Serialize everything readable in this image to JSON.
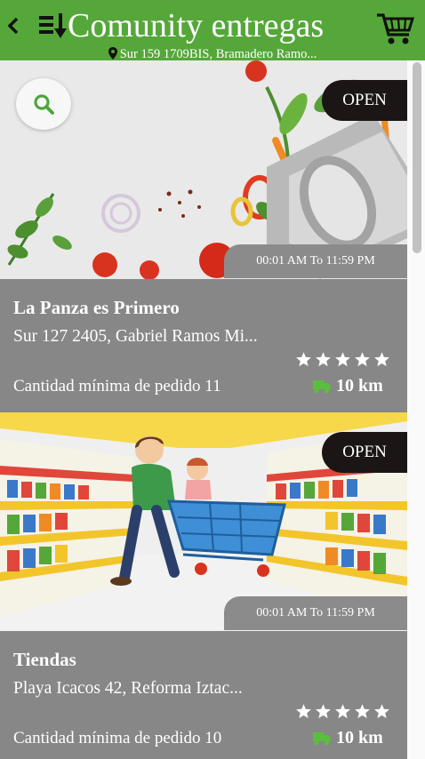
{
  "header": {
    "title": "Comunity entregas",
    "address": "Sur 159 1709BIS, Bramadero Ramo..."
  },
  "colors": {
    "brand_green": "#55a73a",
    "badge_dark": "#1b1515",
    "info_gray": "#878787"
  },
  "icons": [
    "back-icon",
    "sort-icon",
    "cart-icon",
    "location-pin-icon",
    "search-icon",
    "star-icon",
    "truck-icon"
  ],
  "stores": [
    {
      "status": "OPEN",
      "hours": "00:01 AM To 11:59 PM",
      "name": "La Panza es Primero",
      "address": "Sur 127 2405, Gabriel Ramos Mi...",
      "min_order": "Cantidad mínima de pedido 11",
      "rating": 5,
      "distance": "10 km"
    },
    {
      "status": "OPEN",
      "hours": "00:01 AM To 11:59 PM",
      "name": "Tiendas",
      "address": "Playa Icacos 42, Reforma Iztac...",
      "min_order": "Cantidad mínima de pedido 10",
      "rating": 5,
      "distance": "10 km"
    }
  ]
}
